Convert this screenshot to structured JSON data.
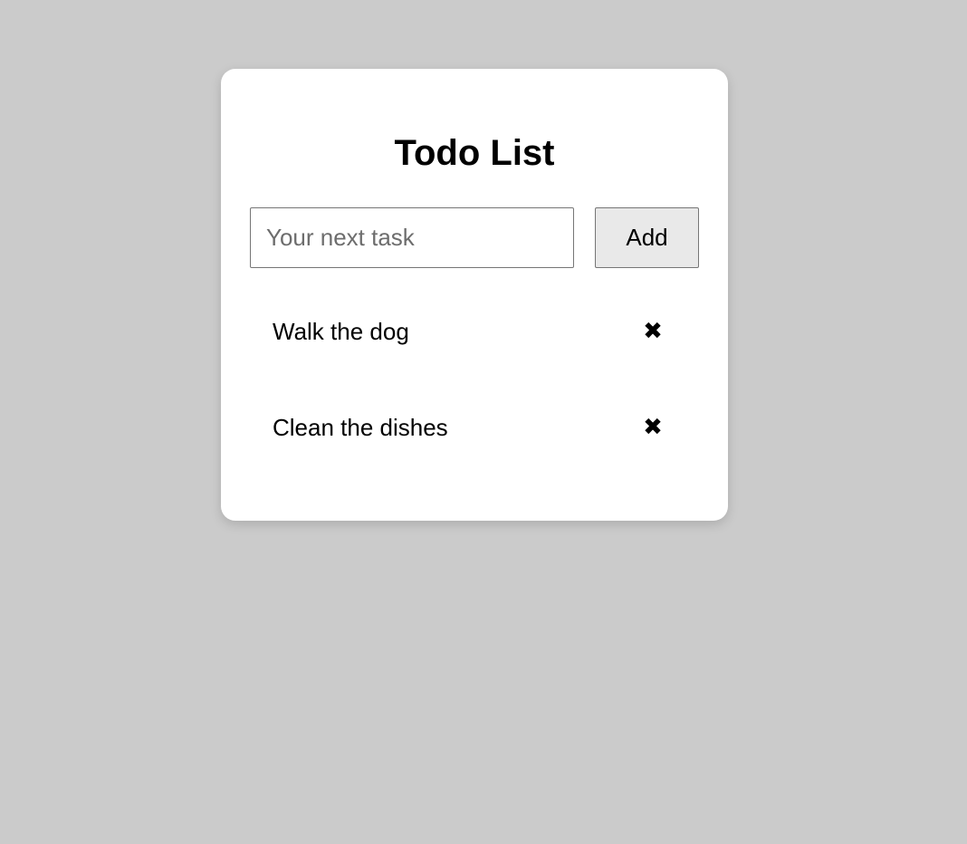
{
  "app": {
    "title": "Todo List"
  },
  "form": {
    "placeholder": "Your next task",
    "value": "",
    "add_label": "Add"
  },
  "todos": [
    {
      "text": "Walk the dog",
      "delete_icon": "✖"
    },
    {
      "text": "Clean the dishes",
      "delete_icon": "✖"
    }
  ],
  "colors": {
    "background": "#cbcbcb",
    "card": "#ffffff",
    "button": "#e9e9e9",
    "border": "#767676"
  }
}
